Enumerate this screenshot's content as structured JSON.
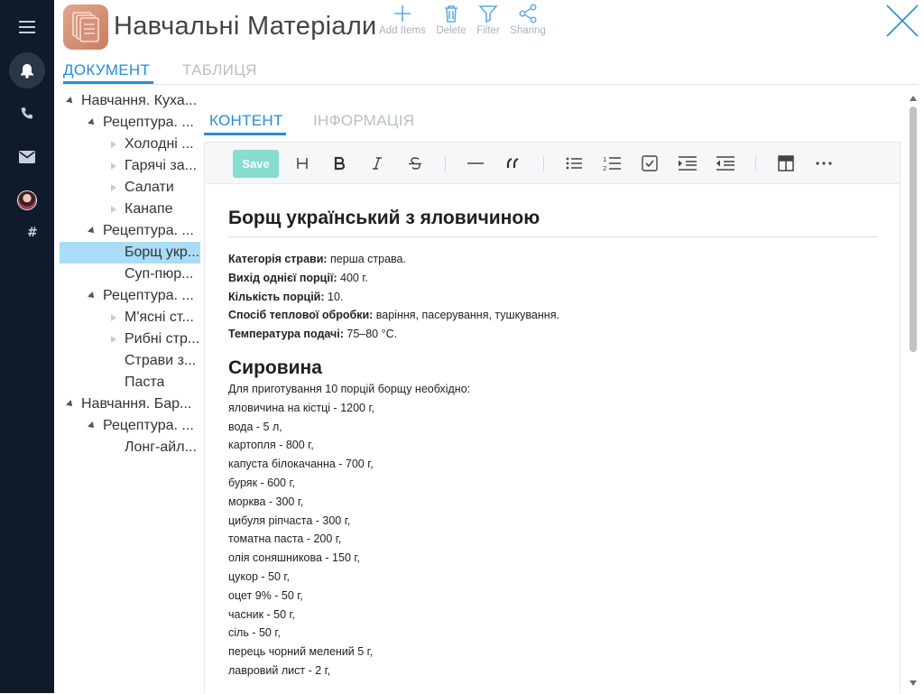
{
  "app": {
    "title": "Навчальні Матеріали",
    "logo_icon": "documents-icon",
    "accent_color": "#2a8bd8",
    "rail_color": "#0f1a2b"
  },
  "rail": {
    "items": [
      {
        "icon": "menu-icon"
      },
      {
        "icon": "bell-icon",
        "active": true
      },
      {
        "icon": "phone-icon"
      },
      {
        "icon": "mail-icon"
      },
      {
        "icon": "avatar"
      },
      {
        "icon": "hash-icon",
        "label": "#"
      }
    ]
  },
  "toolbar": {
    "add_label": "Add Items",
    "delete_label": "Delete",
    "filter_label": "Filter",
    "sharing_label": "Sharing"
  },
  "doc_tabs": {
    "document": "ДОКУМЕНТ",
    "table": "ТАБЛИЦЯ"
  },
  "tree": {
    "rows": [
      {
        "label": "Навчання. Куха...",
        "expanded": true
      },
      {
        "label": "Рецептура. ...",
        "expanded": true
      },
      {
        "label": "Холодні ...",
        "collapsed": true
      },
      {
        "label": "Гарячі за...",
        "collapsed": true
      },
      {
        "label": "Салати",
        "collapsed": true
      },
      {
        "label": "Канапе",
        "collapsed": true
      },
      {
        "label": "Рецептура. ...",
        "expanded": true
      },
      {
        "label": "Борщ укр...",
        "selected": true
      },
      {
        "label": "Суп-пюр..."
      },
      {
        "label": "Рецептура. ...",
        "expanded": true
      },
      {
        "label": "М'ясні ст...",
        "collapsed": true
      },
      {
        "label": "Рибні стр...",
        "collapsed": true
      },
      {
        "label": "Страви з..."
      },
      {
        "label": "Паста"
      },
      {
        "label": "Навчання. Бар...",
        "expanded": true
      },
      {
        "label": "Рецептура. ...",
        "expanded": true
      },
      {
        "label": "Лонг-айл..."
      }
    ]
  },
  "content_tabs": {
    "content": "КОНТЕНТ",
    "info": "ІНФОРМАЦІЯ"
  },
  "editor": {
    "save_label": "Save",
    "tools": [
      "heading-icon",
      "bold-icon",
      "italic-icon",
      "strikethrough-icon",
      "horizontal-rule-icon",
      "quote-icon",
      "bullet-list-icon",
      "numbered-list-icon",
      "checklist-icon",
      "indent-icon",
      "outdent-icon",
      "table-icon",
      "more-icon"
    ]
  },
  "document": {
    "title": "Борщ український з яловичиною",
    "meta": [
      {
        "key": "Категорія страви:",
        "value": " перша страва."
      },
      {
        "key": "Вихід однієї порції:",
        "value": " 400 г."
      },
      {
        "key": "Кількість порцій:",
        "value": " 10."
      },
      {
        "key": "Спосіб теплової обробки:",
        "value": " варіння, пасерування, тушкування."
      },
      {
        "key": "Температура подачі:",
        "value": " 75–80 °С."
      }
    ],
    "section_title": "Сировина",
    "lines": [
      "Для приготування 10 порцій борщу необхідно:",
      "яловичина на кістці - 1200 г,",
      "вода - 5 л,",
      "картопля - 800 г,",
      "капуста білокачанна - 700 г,",
      "буряк - 600 г,",
      "морква - 300 г,",
      "цибуля ріпчаста - 300 г,",
      "томатна паста - 200 г,",
      "олія соняшникова - 150 г,",
      "цукор - 50 г,",
      "оцет 9% - 50 г,",
      "часник - 50 г,",
      "сіль - 50 г,",
      "перець чорний мелений 5 г,",
      "лавровий лист - 2 г,"
    ]
  }
}
